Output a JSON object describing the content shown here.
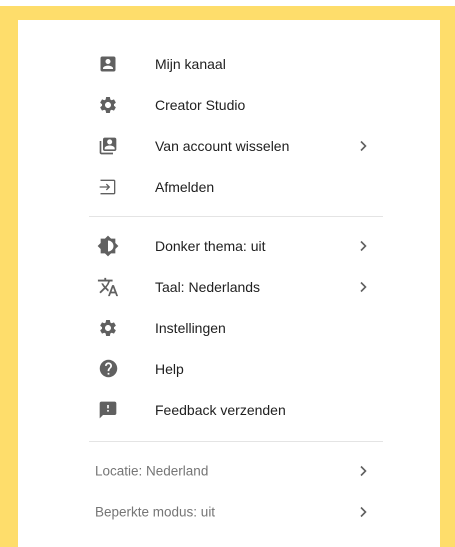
{
  "colors": {
    "frame": "#fedd6b",
    "icon": "#606060",
    "text": "#202020",
    "muted_text": "#757575",
    "divider": "#e4e4e4"
  },
  "menu": {
    "account_section": [
      {
        "label": "Mijn kanaal",
        "icon": "account-box-icon"
      },
      {
        "label": "Creator Studio",
        "icon": "gear-icon"
      },
      {
        "label": "Van account wisselen",
        "icon": "switch-account-icon"
      },
      {
        "label": "Afmelden",
        "icon": "sign-out-icon"
      }
    ],
    "settings_section": [
      {
        "label": "Donker thema: uit",
        "icon": "dark-theme-icon"
      },
      {
        "label": "Taal: Nederlands",
        "icon": "translate-icon"
      },
      {
        "label": "Instellingen",
        "icon": "gear-icon"
      },
      {
        "label": "Help",
        "icon": "help-icon"
      },
      {
        "label": "Feedback verzenden",
        "icon": "feedback-icon"
      }
    ],
    "meta_section": [
      {
        "label": "Locatie: Nederland"
      },
      {
        "label": "Beperkte modus: uit"
      }
    ]
  }
}
